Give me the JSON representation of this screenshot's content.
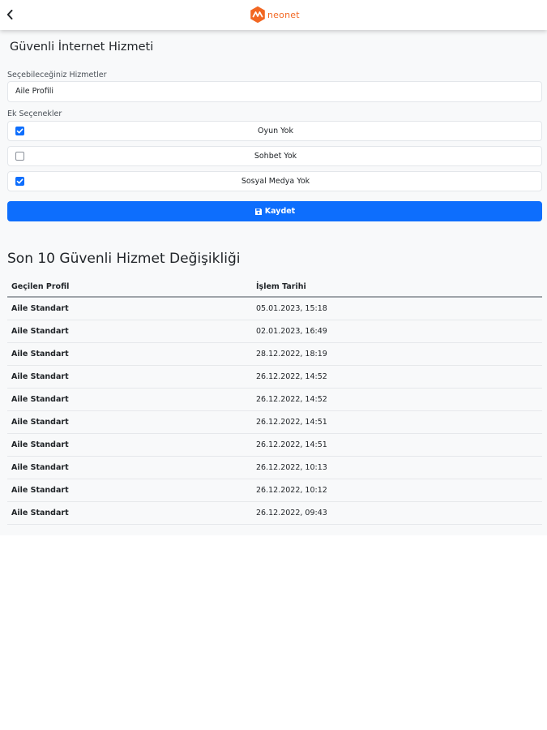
{
  "app": {
    "logo_text": "neonet",
    "brand_color": "#f26722",
    "accent_color": "#0d6efd"
  },
  "form": {
    "title": "Güvenli İnternet Hizmeti",
    "services_label": "Seçebileceğiniz Hizmetler",
    "selected_service": "Aile Profili",
    "extras_label": "Ek Seçenekler",
    "options": [
      {
        "label": "Oyun Yok",
        "checked": true
      },
      {
        "label": "Sohbet Yok",
        "checked": false
      },
      {
        "label": "Sosyal Medya Yok",
        "checked": true
      }
    ],
    "save_label": "Kaydet",
    "save_icon": "floppy-disk-icon"
  },
  "history": {
    "title": "Son 10 Güvenli Hizmet Değişikliği",
    "columns": [
      "Geçilen Profil",
      "İşlem Tarihi"
    ],
    "rows": [
      {
        "profile": "Aile Standart",
        "date": "05.01.2023, 15:18"
      },
      {
        "profile": "Aile Standart",
        "date": "02.01.2023, 16:49"
      },
      {
        "profile": "Aile Standart",
        "date": "28.12.2022, 18:19"
      },
      {
        "profile": "Aile Standart",
        "date": "26.12.2022, 14:52"
      },
      {
        "profile": "Aile Standart",
        "date": "26.12.2022, 14:52"
      },
      {
        "profile": "Aile Standart",
        "date": "26.12.2022, 14:51"
      },
      {
        "profile": "Aile Standart",
        "date": "26.12.2022, 14:51"
      },
      {
        "profile": "Aile Standart",
        "date": "26.12.2022, 10:13"
      },
      {
        "profile": "Aile Standart",
        "date": "26.12.2022, 10:12"
      },
      {
        "profile": "Aile Standart",
        "date": "26.12.2022, 09:43"
      }
    ]
  }
}
